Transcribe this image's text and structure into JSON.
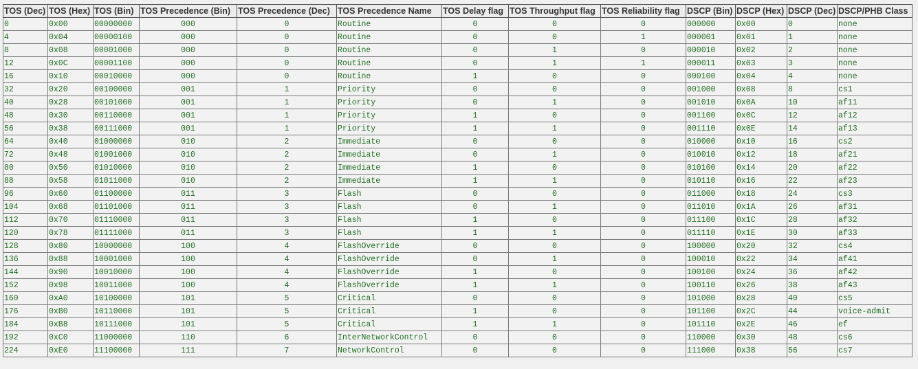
{
  "table": {
    "headers": [
      "TOS (Dec)",
      "TOS (Hex)",
      "TOS (Bin)",
      "TOS Precedence (Bin)",
      "TOS Precedence (Dec)",
      "TOS Precedence Name",
      "TOS Delay flag",
      "TOS Throughput flag",
      "TOS Reliability flag",
      "DSCP (Bin)",
      "DSCP (Hex)",
      "DSCP (Dec)",
      "DSCP/PHB Class"
    ],
    "rows": [
      [
        "0",
        "0x00",
        "00000000",
        "000",
        "0",
        "Routine",
        "0",
        "0",
        "0",
        "000000",
        "0x00",
        "0",
        "none"
      ],
      [
        "4",
        "0x04",
        "00000100",
        "000",
        "0",
        "Routine",
        "0",
        "0",
        "1",
        "000001",
        "0x01",
        "1",
        "none"
      ],
      [
        "8",
        "0x08",
        "00001000",
        "000",
        "0",
        "Routine",
        "0",
        "1",
        "0",
        "000010",
        "0x02",
        "2",
        "none"
      ],
      [
        "12",
        "0x0C",
        "00001100",
        "000",
        "0",
        "Routine",
        "0",
        "1",
        "1",
        "000011",
        "0x03",
        "3",
        "none"
      ],
      [
        "16",
        "0x10",
        "00010000",
        "000",
        "0",
        "Routine",
        "1",
        "0",
        "0",
        "000100",
        "0x04",
        "4",
        "none"
      ],
      [
        "32",
        "0x20",
        "00100000",
        "001",
        "1",
        "Priority",
        "0",
        "0",
        "0",
        "001000",
        "0x08",
        "8",
        "cs1"
      ],
      [
        "40",
        "0x28",
        "00101000",
        "001",
        "1",
        "Priority",
        "0",
        "1",
        "0",
        "001010",
        "0x0A",
        "10",
        "af11"
      ],
      [
        "48",
        "0x30",
        "00110000",
        "001",
        "1",
        "Priority",
        "1",
        "0",
        "0",
        "001100",
        "0x0C",
        "12",
        "af12"
      ],
      [
        "56",
        "0x38",
        "00111000",
        "001",
        "1",
        "Priority",
        "1",
        "1",
        "0",
        "001110",
        "0x0E",
        "14",
        "af13"
      ],
      [
        "64",
        "0x40",
        "01000000",
        "010",
        "2",
        "Immediate",
        "0",
        "0",
        "0",
        "010000",
        "0x10",
        "16",
        "cs2"
      ],
      [
        "72",
        "0x48",
        "01001000",
        "010",
        "2",
        "Immediate",
        "0",
        "1",
        "0",
        "010010",
        "0x12",
        "18",
        "af21"
      ],
      [
        "80",
        "0x50",
        "01010000",
        "010",
        "2",
        "Immediate",
        "1",
        "0",
        "0",
        "010100",
        "0x14",
        "20",
        "af22"
      ],
      [
        "88",
        "0x58",
        "01011000",
        "010",
        "2",
        "Immediate",
        "1",
        "1",
        "0",
        "010110",
        "0x16",
        "22",
        "af23"
      ],
      [
        "96",
        "0x60",
        "01100000",
        "011",
        "3",
        "Flash",
        "0",
        "0",
        "0",
        "011000",
        "0x18",
        "24",
        "cs3"
      ],
      [
        "104",
        "0x68",
        "01101000",
        "011",
        "3",
        "Flash",
        "0",
        "1",
        "0",
        "011010",
        "0x1A",
        "26",
        "af31"
      ],
      [
        "112",
        "0x70",
        "01110000",
        "011",
        "3",
        "Flash",
        "1",
        "0",
        "0",
        "011100",
        "0x1C",
        "28",
        "af32"
      ],
      [
        "120",
        "0x78",
        "01111000",
        "011",
        "3",
        "Flash",
        "1",
        "1",
        "0",
        "011110",
        "0x1E",
        "30",
        "af33"
      ],
      [
        "128",
        "0x80",
        "10000000",
        "100",
        "4",
        "FlashOverride",
        "0",
        "0",
        "0",
        "100000",
        "0x20",
        "32",
        "cs4"
      ],
      [
        "136",
        "0x88",
        "10001000",
        "100",
        "4",
        "FlashOverride",
        "0",
        "1",
        "0",
        "100010",
        "0x22",
        "34",
        "af41"
      ],
      [
        "144",
        "0x90",
        "10010000",
        "100",
        "4",
        "FlashOverride",
        "1",
        "0",
        "0",
        "100100",
        "0x24",
        "36",
        "af42"
      ],
      [
        "152",
        "0x98",
        "10011000",
        "100",
        "4",
        "FlashOverride",
        "1",
        "1",
        "0",
        "100110",
        "0x26",
        "38",
        "af43"
      ],
      [
        "160",
        "0xA0",
        "10100000",
        "101",
        "5",
        "Critical",
        "0",
        "0",
        "0",
        "101000",
        "0x28",
        "40",
        "cs5"
      ],
      [
        "176",
        "0xB0",
        "10110000",
        "101",
        "5",
        "Critical",
        "1",
        "0",
        "0",
        "101100",
        "0x2C",
        "44",
        "voice-admit"
      ],
      [
        "184",
        "0xB8",
        "10111000",
        "101",
        "5",
        "Critical",
        "1",
        "1",
        "0",
        "101110",
        "0x2E",
        "46",
        "ef"
      ],
      [
        "192",
        "0xC0",
        "11000000",
        "110",
        "6",
        "InterNetworkControl",
        "0",
        "0",
        "0",
        "110000",
        "0x30",
        "48",
        "cs6"
      ],
      [
        "224",
        "0xE0",
        "11100000",
        "111",
        "7",
        "NetworkControl",
        "0",
        "0",
        "0",
        "111000",
        "0x38",
        "56",
        "cs7"
      ]
    ]
  }
}
